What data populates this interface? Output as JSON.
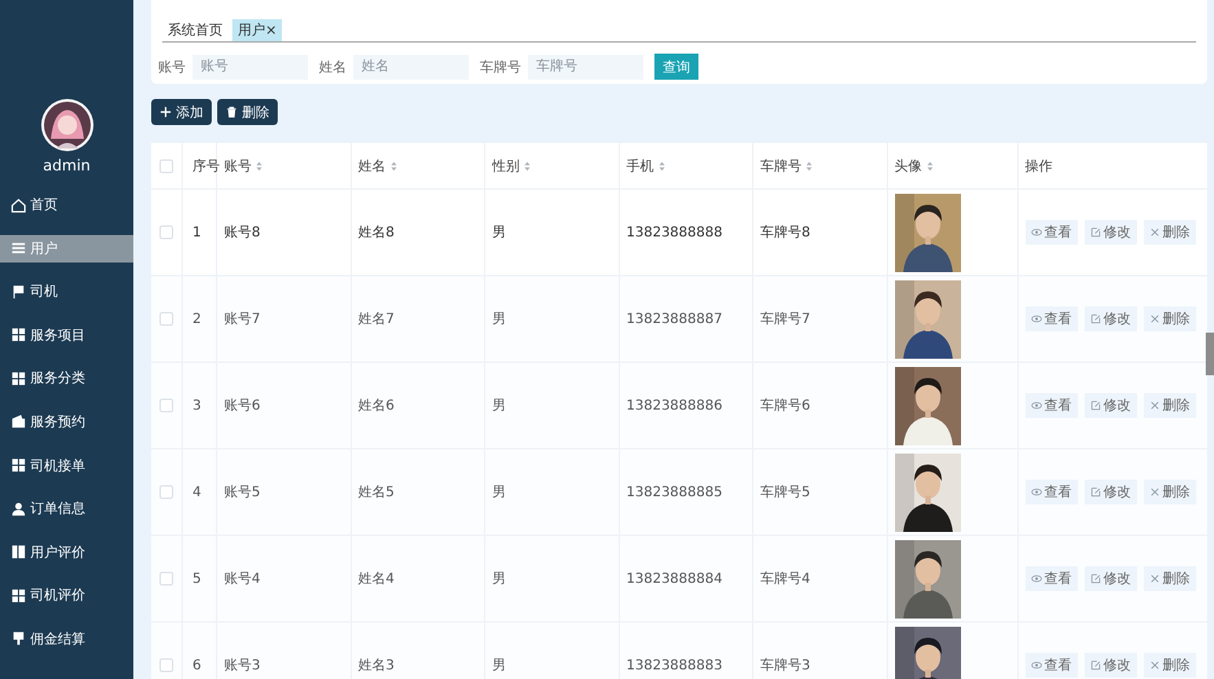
{
  "sidebar": {
    "user": {
      "name": "admin"
    },
    "items": [
      {
        "label": "首页",
        "selected": false
      },
      {
        "label": "用户",
        "selected": true
      },
      {
        "label": "司机",
        "selected": false
      },
      {
        "label": "服务项目",
        "selected": false
      },
      {
        "label": "服务分类",
        "selected": false
      },
      {
        "label": "服务预约",
        "selected": false
      },
      {
        "label": "司机接单",
        "selected": false
      },
      {
        "label": "订单信息",
        "selected": false
      },
      {
        "label": "用户评价",
        "selected": false
      },
      {
        "label": "司机评价",
        "selected": false
      },
      {
        "label": "佣金结算",
        "selected": false
      }
    ]
  },
  "tabs": [
    {
      "label": "系统首页",
      "selected": false
    },
    {
      "label": "用户",
      "selected": true,
      "close": "×"
    }
  ],
  "search": {
    "fields": [
      {
        "label": "账号",
        "placeholder": "账号"
      },
      {
        "label": "姓名",
        "placeholder": "姓名"
      },
      {
        "label": "车牌号",
        "placeholder": "车牌号"
      }
    ],
    "button": "查询"
  },
  "toolbar": [
    {
      "kind": "add",
      "label": "添加"
    },
    {
      "kind": "delete",
      "label": "删除"
    }
  ],
  "table": {
    "columns": [
      {
        "kind": "checkbox",
        "checked": false
      },
      {
        "label": "序号",
        "sortable": false
      },
      {
        "label": "账号",
        "sortable": true
      },
      {
        "label": "姓名",
        "sortable": true
      },
      {
        "label": "性别",
        "sortable": true
      },
      {
        "label": "手机",
        "sortable": true
      },
      {
        "label": "车牌号",
        "sortable": true
      },
      {
        "label": "头像",
        "sortable": true
      },
      {
        "label": "操作",
        "sortable": false
      }
    ],
    "rows": [
      {
        "checked": false,
        "hovered": true,
        "index": "1",
        "account": "账号8",
        "name": "姓名8",
        "gender": "男",
        "phone": "13823888888",
        "plate": "车牌号8",
        "actions": [
          {
            "kind": "view",
            "label": "查看"
          },
          {
            "kind": "edit",
            "label": "修改"
          },
          {
            "kind": "delete",
            "label": "删除"
          }
        ]
      },
      {
        "checked": false,
        "hovered": false,
        "index": "2",
        "account": "账号7",
        "name": "姓名7",
        "gender": "男",
        "phone": "13823888887",
        "plate": "车牌号7",
        "actions": [
          {
            "kind": "view",
            "label": "查看"
          },
          {
            "kind": "edit",
            "label": "修改"
          },
          {
            "kind": "delete",
            "label": "删除"
          }
        ]
      },
      {
        "checked": false,
        "hovered": false,
        "index": "3",
        "account": "账号6",
        "name": "姓名6",
        "gender": "男",
        "phone": "13823888886",
        "plate": "车牌号6",
        "actions": [
          {
            "kind": "view",
            "label": "查看"
          },
          {
            "kind": "edit",
            "label": "修改"
          },
          {
            "kind": "delete",
            "label": "删除"
          }
        ]
      },
      {
        "checked": false,
        "hovered": false,
        "index": "4",
        "account": "账号5",
        "name": "姓名5",
        "gender": "男",
        "phone": "13823888885",
        "plate": "车牌号5",
        "actions": [
          {
            "kind": "view",
            "label": "查看"
          },
          {
            "kind": "edit",
            "label": "修改"
          },
          {
            "kind": "delete",
            "label": "删除"
          }
        ]
      },
      {
        "checked": false,
        "hovered": false,
        "index": "5",
        "account": "账号4",
        "name": "姓名4",
        "gender": "男",
        "phone": "13823888884",
        "plate": "车牌号4",
        "actions": [
          {
            "kind": "view",
            "label": "查看"
          },
          {
            "kind": "edit",
            "label": "修改"
          },
          {
            "kind": "delete",
            "label": "删除"
          }
        ]
      },
      {
        "checked": false,
        "hovered": false,
        "index": "6",
        "account": "账号3",
        "name": "姓名3",
        "gender": "男",
        "phone": "13823888883",
        "plate": "车牌号3",
        "actions": [
          {
            "kind": "view",
            "label": "查看"
          },
          {
            "kind": "edit",
            "label": "修改"
          },
          {
            "kind": "delete",
            "label": "删除"
          }
        ]
      }
    ]
  }
}
